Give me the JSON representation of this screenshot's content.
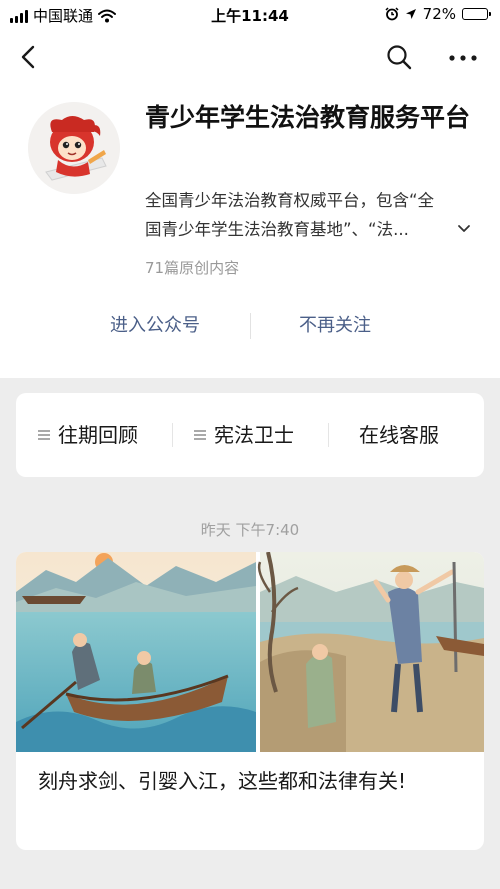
{
  "status_bar": {
    "carrier": "中国联通",
    "time": "上午11:44",
    "battery": "72%",
    "battery_level": 0.72
  },
  "nav": {
    "back_icon": "chevron-left-icon",
    "search_icon": "search-icon",
    "more_icon": "more-dots-icon"
  },
  "profile": {
    "title": "青少年学生法治教育服务平台",
    "description": "全国青少年法治教育权威平台，包含“全国青少年学生法治教育基地”、“法...",
    "article_count": "71篇原创内容"
  },
  "actions": {
    "enter_label": "进入公众号",
    "unfollow_label": "不再关注"
  },
  "menu": {
    "items": [
      {
        "label": "往期回顾",
        "has_submenu": true
      },
      {
        "label": "宪法卫士",
        "has_submenu": true
      },
      {
        "label": "在线客服",
        "has_submenu": false
      }
    ]
  },
  "feed": {
    "timestamp": "昨天 下午7:40",
    "article": {
      "title": "刻舟求剑、引婴入江，这些都和法律有关!"
    }
  },
  "colors": {
    "link": "#4b5f88",
    "background": "#ededed",
    "card": "#ffffff"
  }
}
